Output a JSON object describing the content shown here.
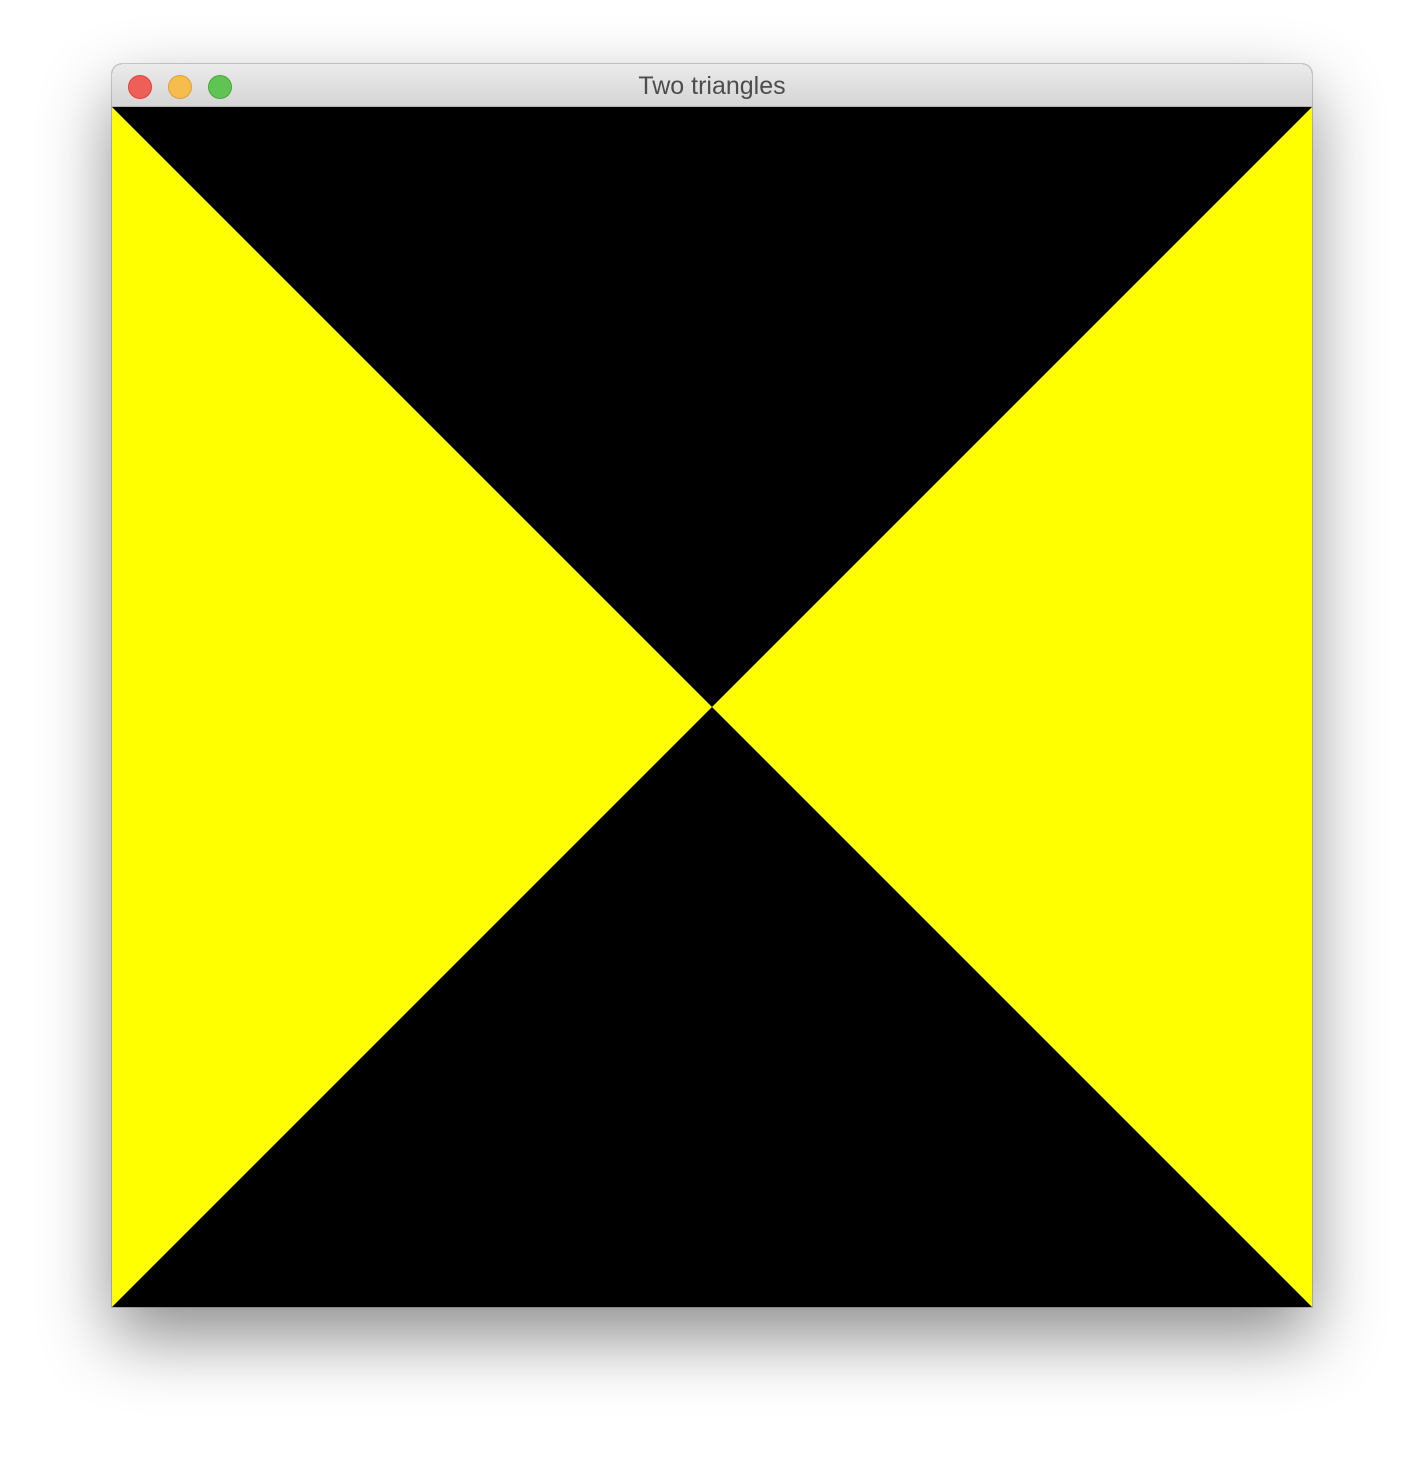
{
  "window": {
    "title": "Two triangles",
    "buttons": {
      "close": {
        "fill": "#ee5f57",
        "border": "#d9473f"
      },
      "minimize": {
        "fill": "#f7bc4e",
        "border": "#dca036"
      },
      "zoom": {
        "fill": "#5fc454",
        "border": "#48a83d"
      }
    }
  },
  "scene": {
    "background_color": "#000000",
    "triangle_color": "#ffff00",
    "triangles": [
      {
        "name": "left",
        "vertices": [
          [
            0,
            0
          ],
          [
            0.5,
            0.5
          ],
          [
            0,
            1
          ]
        ]
      },
      {
        "name": "right",
        "vertices": [
          [
            1,
            0
          ],
          [
            0.5,
            0.5
          ],
          [
            1,
            1
          ]
        ]
      }
    ]
  }
}
